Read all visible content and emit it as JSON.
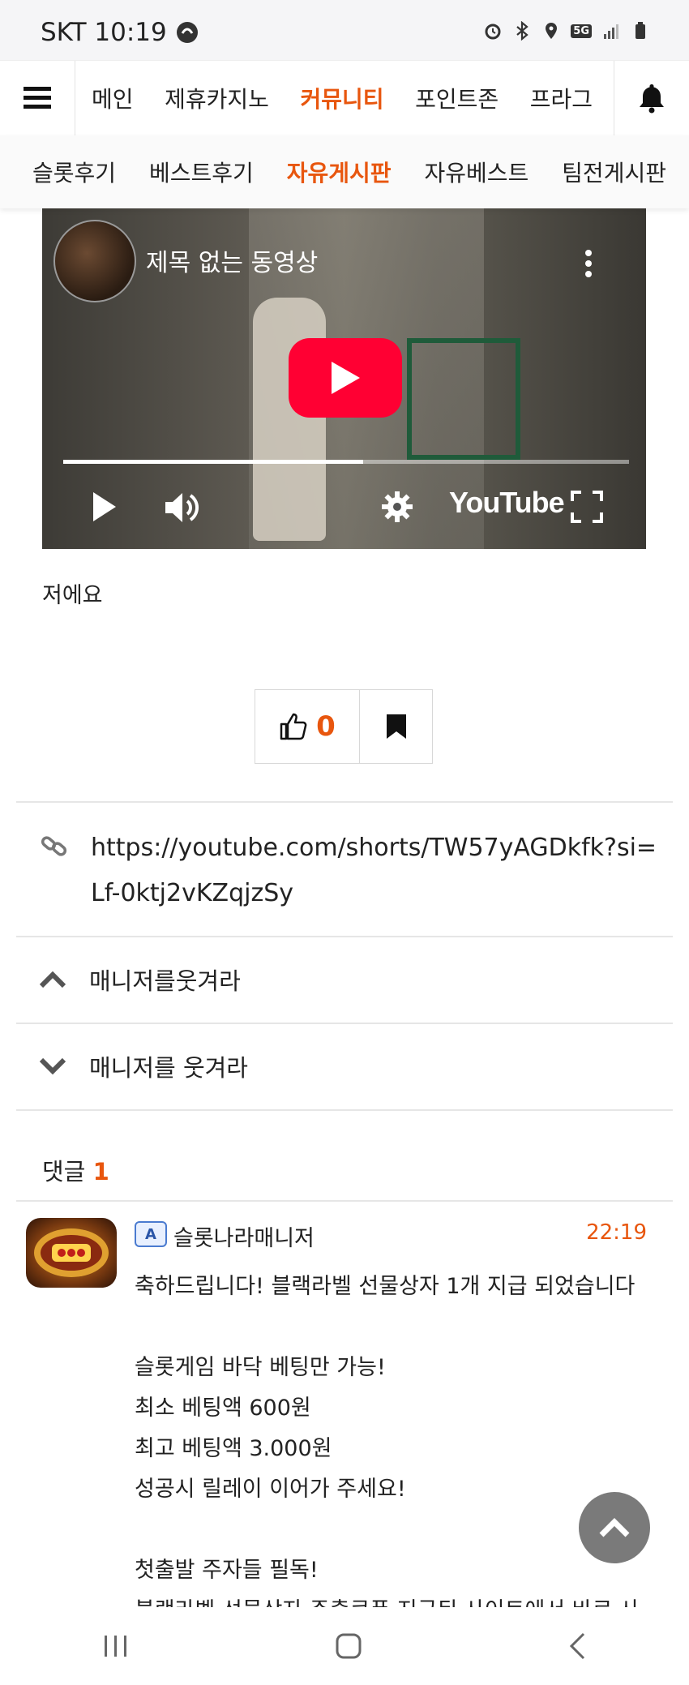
{
  "status_bar": {
    "carrier_time": "SKT 10:19",
    "network": "5G"
  },
  "main_nav": {
    "items": [
      {
        "label": "메인"
      },
      {
        "label": "제휴카지노"
      },
      {
        "label": "커뮤니티",
        "active": true
      },
      {
        "label": "포인트존"
      },
      {
        "label": "프라그"
      }
    ]
  },
  "sub_nav": {
    "items": [
      {
        "label": "슬롯후기"
      },
      {
        "label": "베스트후기"
      },
      {
        "label": "자유게시판",
        "active": true
      },
      {
        "label": "자유베스트"
      },
      {
        "label": "팀전게시판"
      }
    ]
  },
  "video": {
    "title": "제목 없는 동영상",
    "brand": "YouTube",
    "progress": 0.53
  },
  "post": {
    "text": "저에요"
  },
  "actions": {
    "like_count": "0"
  },
  "link": {
    "url": "https://youtube.com/shorts/TW57yAGDkfk?si=Lf-0ktj2vKZqjzSy"
  },
  "post_nav": {
    "prev_title": "매니저를웃겨라",
    "next_title": "매니저를 웃겨라"
  },
  "comments": {
    "label": "댓글",
    "count": "1",
    "items": [
      {
        "badge": "A",
        "author": "슬롯나라매니저",
        "time": "22:19",
        "lines": [
          "축하드립니다! 블랙라벨 선물상자 1개 지급 되었습니다",
          "",
          "슬롯게임 바닥 베팅만 가능!",
          "최소 베팅액 600원",
          "최고 베팅액 3.000원",
          "성공시 릴레이 이어가 주세요!",
          "",
          "첫출발 주자들 필독!",
          "블랙라벨 선물상자 주출쿠폰 지급된 사이트에서 바로 사"
        ]
      }
    ]
  },
  "colors": {
    "accent": "#e8560e",
    "youtube_red": "#ff0033"
  }
}
